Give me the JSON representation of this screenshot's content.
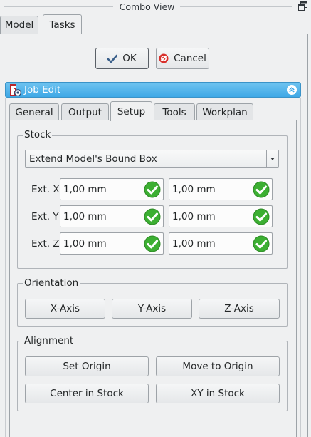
{
  "window": {
    "title": "Combo View"
  },
  "main_tabs": [
    {
      "label": "Model"
    },
    {
      "label": "Tasks"
    }
  ],
  "dialog_buttons": {
    "ok": "OK",
    "cancel": "Cancel"
  },
  "task_panel": {
    "title": "Job Edit"
  },
  "tabs": [
    {
      "label": "General"
    },
    {
      "label": "Output"
    },
    {
      "label": "Setup"
    },
    {
      "label": "Tools"
    },
    {
      "label": "Workplan"
    }
  ],
  "active_tab": "Setup",
  "stock": {
    "title": "Stock",
    "mode": "Extend Model's Bound Box",
    "rows": [
      {
        "label": "Ext. X",
        "neg": "1,00 mm",
        "pos": "1,00 mm"
      },
      {
        "label": "Ext. Y",
        "neg": "1,00 mm",
        "pos": "1,00 mm"
      },
      {
        "label": "Ext. Z",
        "neg": "1,00 mm",
        "pos": "1,00 mm"
      }
    ]
  },
  "orientation": {
    "title": "Orientation",
    "buttons": [
      "X-Axis",
      "Y-Axis",
      "Z-Axis"
    ]
  },
  "alignment": {
    "title": "Alignment",
    "buttons": [
      "Set Origin",
      "Move to Origin",
      "Center in Stock",
      "XY in Stock"
    ]
  },
  "colors": {
    "accent": "#3ea8e6",
    "valid_green": "#3caf32",
    "cancel_red": "#d9302c"
  }
}
